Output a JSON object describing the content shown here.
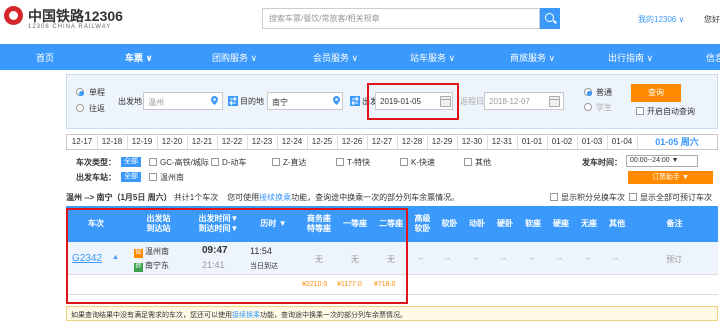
{
  "header": {
    "logo_cn": "中国铁路12306",
    "logo_en": "12306 CHINA RAILWAY",
    "search_placeholder": "搜索车票/餐饮/常旅客/相关规章",
    "my_link": "我的12306 ∨",
    "user_link": "您好"
  },
  "nav": [
    "首页",
    "车票 ∨",
    "团购服务 ∨",
    "会员服务 ∨",
    "站车服务 ∨",
    "商旅服务 ∨",
    "出行指南 ∨",
    "信息"
  ],
  "query": {
    "trip_single": "单程",
    "trip_round": "往返",
    "from_label": "出发地",
    "from_value": "温州",
    "to_label": "目的地",
    "to_value": "南宁",
    "depart_label": "出发日",
    "depart_value": "2019-01-05",
    "return_label": "返程日",
    "return_value": "2018-12-07",
    "type_normal": "普通",
    "type_student": "学生",
    "query_button": "查询",
    "auto_query": "开启自动查询"
  },
  "dates": [
    "12-17",
    "12-18",
    "12-19",
    "12-20",
    "12-21",
    "12-22",
    "12-23",
    "12-24",
    "12-25",
    "12-26",
    "12-27",
    "12-28",
    "12-29",
    "12-30",
    "12-31",
    "01-01",
    "01-02",
    "01-03",
    "01-04"
  ],
  "selected_date": "01-05 周六",
  "filters": {
    "train_type_label": "车次类型：",
    "all_tag": "全部",
    "types": [
      "GC-高铁/城际",
      "D-动车",
      "Z-直达",
      "T-特快",
      "K-快速",
      "其他"
    ],
    "station_label": "出发车站：",
    "stations": [
      "温州南"
    ],
    "depart_time_label": "发车时间：",
    "depart_time_value": "00:00--24:00 ▼",
    "order_button": "订票助手 ▼"
  },
  "summary": {
    "route": "温州 --> 南宁（1月5日 周六）",
    "count": "共计1个车次",
    "tip_pre": "您可使用",
    "tip_link": "接续换乘",
    "tip_post": "功能，查询途中换乘一次的部分列车余票情况。",
    "show_points": "显示积分兑换车次",
    "show_all": "显示全部可预订车次"
  },
  "table": {
    "headers": [
      "车次",
      "出发站\n到达站",
      "出发时间▼\n到达时间▼",
      "历时 ▼",
      "商务座\n特等座",
      "一等座",
      "二等座",
      "高级\n软卧",
      "软卧",
      "动卧",
      "硬卧",
      "软座",
      "硬座",
      "无座",
      "其他",
      "备注"
    ],
    "row": {
      "train": "G2342",
      "from_station": "温州南",
      "to_station": "南宁东",
      "depart_time": "09:47",
      "arrive_time": "21:41",
      "duration": "11:54",
      "arrive_note": "当日到达",
      "business": "无",
      "first": "无",
      "second": "无",
      "dashes": [
        "--",
        "--",
        "--",
        "--",
        "--",
        "--",
        "--",
        "--"
      ],
      "remark": "预订",
      "price_business": "¥2210.0",
      "price_first": "¥1177.0",
      "price_second": "¥718.0"
    }
  },
  "notice": {
    "pre": "如果查询结果中没有满足需求的车次，您还可以使用",
    "link": "接续换乘",
    "post": "功能，查询途中换乘一次的部分列车余票情况。"
  }
}
